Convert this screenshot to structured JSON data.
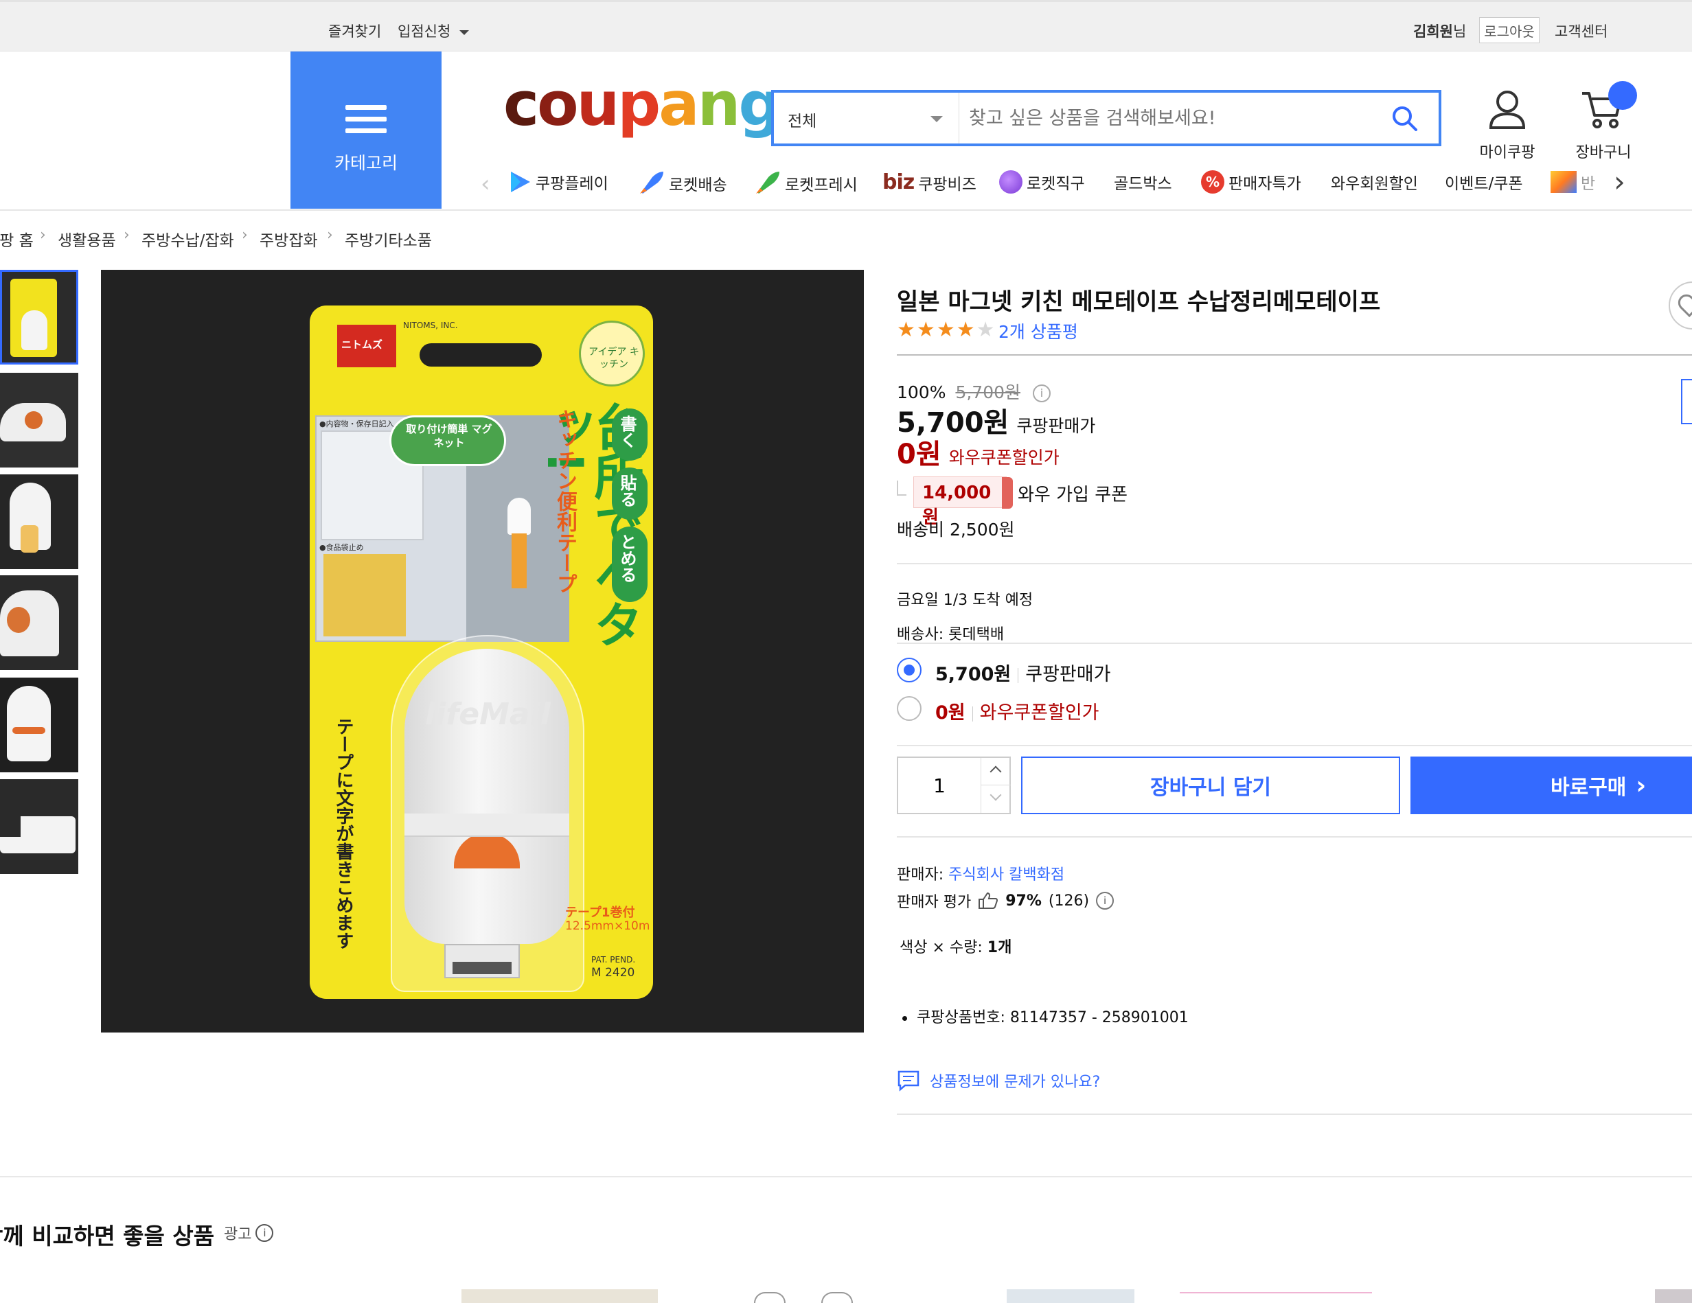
{
  "topbar": {
    "favorites": "즐겨찾기",
    "seller_signup": "입점신청",
    "user_name": "김희원",
    "user_suffix": "님",
    "logout": "로그아웃",
    "customer_center": "고객센터"
  },
  "header": {
    "category_label": "카테고리",
    "logo": {
      "c": "c",
      "o": "o",
      "u": "u",
      "p": "p",
      "a": "a",
      "n": "n",
      "g": "g"
    },
    "search_scope": "전체",
    "search_placeholder": "찾고 싶은 상품을 검색해보세요!",
    "mycoupang": "마이쿠팡",
    "cart": "장바구니"
  },
  "category_nav": [
    {
      "label": "쿠팡플레이",
      "icon": "play-icon"
    },
    {
      "label": "로켓배송",
      "icon": "rocket-icon"
    },
    {
      "label": "로켓프레시",
      "icon": "rocket-fresh-icon"
    },
    {
      "label": "쿠팡비즈",
      "icon": "biz-icon",
      "prefix": "biz"
    },
    {
      "label": "로켓직구",
      "icon": "rocket-global-icon"
    },
    {
      "label": "골드박스",
      "icon": ""
    },
    {
      "label": "판매자특가",
      "icon": "percent-icon"
    },
    {
      "label": "와우회원할인",
      "icon": ""
    },
    {
      "label": "이벤트/쿠폰",
      "icon": ""
    },
    {
      "label": "반",
      "icon": "sale-icon"
    }
  ],
  "breadcrumb": [
    "쿠팡 홈",
    "생활용품",
    "주방수납/잡화",
    "주방잡화",
    "주방기타소품"
  ],
  "product": {
    "title": "일본 마그넷 키친 메모테이프 수납정리메모테이프",
    "rating": 4,
    "rating_max": 5,
    "review_count": "2개 상품평",
    "discount_rate": "100%",
    "original_price": "5,700원",
    "sale_price": "5,700원",
    "sale_label": "쿠팡판매가",
    "wow_price": "0원",
    "wow_label": "와우쿠폰할인가",
    "coupon_amount": "14,000원",
    "coupon_label": "와우 가입 쿠폰",
    "shipping_fee": "배송비 2,500원",
    "arrival": "금요일 1/3 도착 예정",
    "carrier": "배송사: 롯데택배",
    "options": [
      {
        "price": "5,700원",
        "label": "쿠팡판매가",
        "selected": true
      },
      {
        "price": "0원",
        "label": "와우쿠폰할인가",
        "selected": false
      }
    ],
    "quantity": "1",
    "add_to_cart": "장바구니 담기",
    "buy_now": "바로구매",
    "seller_label": "판매자: ",
    "seller_name": "주식회사 칼백화점",
    "seller_rating_label": "판매자 평가",
    "seller_rating": "97%",
    "seller_rating_count": "(126)",
    "option_summary_label": "색상 × 수량:",
    "option_summary_value": "1개",
    "product_number": "쿠팡상품번호: 81147357 - 258901001",
    "report_link": "상품정보에 문제가 있나요?"
  },
  "package": {
    "brand": "NITOMS, INC.",
    "logo": "ニトムズ",
    "badge": "アイデア キッチン",
    "magnet": "取り付け簡単 マグネット",
    "bubble1": "書く",
    "bubble2": "貼る",
    "bubble3": "とめる",
    "headline": "台所でペタッ!",
    "sub": "キッチン便利テープ",
    "side": "テープに文字が書きこめます",
    "device": "lifeMail",
    "tape": "テープ1巻付",
    "tape_size": "12.5mm×10m",
    "pat": "PAT. PEND.",
    "model": "M 2420",
    "note1": "●内容物・保存日記入",
    "note2": "●食品袋止め"
  },
  "related": {
    "title": "함께 비교하면 좋을 상품",
    "ad_label": "광고"
  },
  "colors": {
    "accent": "#346aff",
    "category_blue": "#4285f4",
    "price_red": "#ae0000",
    "coupon_bg": "#fdeeee"
  }
}
